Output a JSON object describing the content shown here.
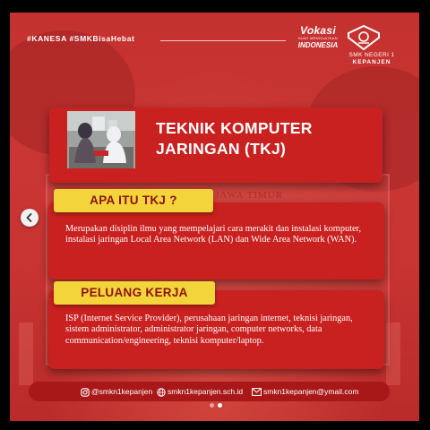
{
  "post": {
    "hashtags": "#KANESA  #SMKBisaHebat",
    "brand": {
      "vokasi_title": "Vokasi",
      "vokasi_sub": "KUAT MENGUATKAN",
      "vokasi_country": "INDONESIA",
      "school_name_line1": "SMK NEGERI 1",
      "school_name_line2": "KEPANJEN"
    },
    "title": "TEKNIK KOMPUTER JARINGAN (TKJ)",
    "section1": {
      "heading": "APA ITU TKJ ?",
      "body": "Merupakan disiplin ilmu yang mempelajari cara merakit dan instalasi komputer, instalasi jaringan Local Area Network (LAN) dan Wide Area Network (WAN)."
    },
    "section2": {
      "heading": "PELUANG KERJA",
      "body": "ISP (Internet Service Provider), perusahaan jaringan internet, teknisi jaringan, sistem administrator, administrator jaringan, computer networks, data communication/engineering, teknisi komputer/laptop."
    },
    "background_sign": "INSI JAWA TIMUR",
    "footer": {
      "instagram": "@smkn1kepanjen",
      "website": "smkn1kepanjen.sch.id",
      "email": "smkn1kepanjen@ymail.com"
    }
  },
  "carousel": {
    "prev_icon": "chevron-left-icon",
    "dot_count": 2,
    "active_dot": 1
  },
  "colors": {
    "background_red": "#c4312f",
    "card_red": "#c8211f",
    "tag_yellow": "#f3d43a",
    "tag_text": "#8b1212",
    "footer_red": "#a91818"
  }
}
